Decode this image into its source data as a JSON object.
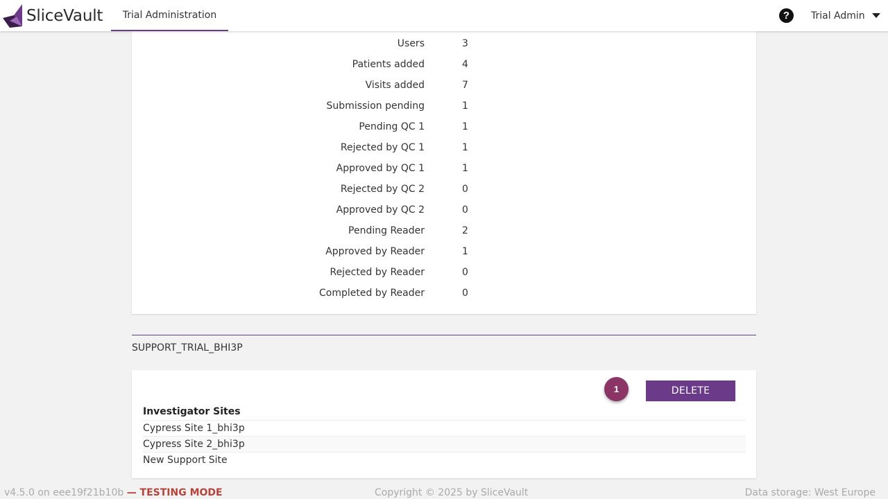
{
  "header": {
    "app_name": "SliceVault",
    "nav_tab": "Trial Administration",
    "help_symbol": "?",
    "user_name": "Trial Admin",
    "accent_color": "#6b3a88"
  },
  "stats": [
    {
      "label": "Users",
      "value": "3"
    },
    {
      "label": "Patients added",
      "value": "4"
    },
    {
      "label": "Visits added",
      "value": "7"
    },
    {
      "label": "Submission pending",
      "value": "1"
    },
    {
      "label": "Pending QC 1",
      "value": "1"
    },
    {
      "label": "Rejected by QC 1",
      "value": "1"
    },
    {
      "label": "Approved by QC 1",
      "value": "1"
    },
    {
      "label": "Rejected by QC 2",
      "value": "0"
    },
    {
      "label": "Approved by QC 2",
      "value": "0"
    },
    {
      "label": "Pending Reader",
      "value": "2"
    },
    {
      "label": "Approved by Reader",
      "value": "1"
    },
    {
      "label": "Rejected by Reader",
      "value": "0"
    },
    {
      "label": "Completed by Reader",
      "value": "0"
    }
  ],
  "trial": {
    "name": "SUPPORT_TRIAL_BHI3P",
    "badge_count": "1",
    "delete_label": "DELETE",
    "sites_heading": "Investigator Sites",
    "sites": [
      "Cypress Site 1_bhi3p",
      "Cypress Site 2_bhi3p",
      "New Support Site"
    ]
  },
  "footer": {
    "version": "v4.5.0 on eee19f21b10b",
    "testing": "— TESTING MODE",
    "copyright": "Copyright © 2025 by SliceVault",
    "storage": "Data storage: West Europe"
  }
}
